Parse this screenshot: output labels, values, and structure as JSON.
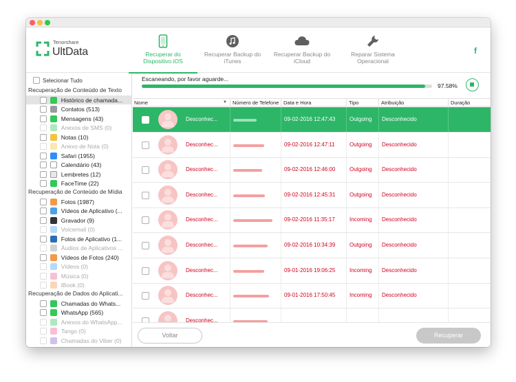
{
  "app": {
    "brand_small": "Tenorshare",
    "brand_big": "UltData",
    "accent": "#2db668"
  },
  "nav": [
    {
      "label1": "Recuperar do",
      "label2": "Dispositivo iOS",
      "icon": "phone-icon",
      "active": true
    },
    {
      "label1": "Recuperar Backup do",
      "label2": "iTunes",
      "icon": "music-note-icon",
      "active": false
    },
    {
      "label1": "Recuperar Backup do",
      "label2": "iCloud",
      "icon": "cloud-icon",
      "active": false
    },
    {
      "label1": "Reparar Sistema",
      "label2": "Operacional",
      "icon": "wrench-icon",
      "active": false
    }
  ],
  "facebook_label": "f",
  "sidebar": {
    "select_all": "Selecionar Tudo",
    "groups": [
      {
        "title": "Recuperação de Conteúdo de Texto",
        "items": [
          {
            "label": "Histórico de chamada...",
            "icon_color": "#34c759",
            "active": true
          },
          {
            "label": "Contatos (513)",
            "icon_color": "#9a9a9a"
          },
          {
            "label": "Mensagens (43)",
            "icon_color": "#34c759"
          },
          {
            "label": "Anexos de SMS (0)",
            "icon_color": "#34c759",
            "disabled": true
          },
          {
            "label": "Notas (10)",
            "icon_color": "#f5c242"
          },
          {
            "label": "Anexo de Nota (0)",
            "icon_color": "#f5c242",
            "disabled": true
          },
          {
            "label": "Safari (1955)",
            "icon_color": "#2f8ff5"
          },
          {
            "label": "Calendário (43)",
            "icon_color": "#ffffff"
          },
          {
            "label": "Lembretes (12)",
            "icon_color": "#e8e8e8"
          },
          {
            "label": "FaceTime (22)",
            "icon_color": "#34c759"
          }
        ]
      },
      {
        "title": "Recuperação de Conteúdo de Mídia",
        "items": [
          {
            "label": "Fotos (1987)",
            "icon_color": "#f2994a"
          },
          {
            "label": "Vídeos de Aplicativo (...",
            "icon_color": "#4aa3e8"
          },
          {
            "label": "Gravador (9)",
            "icon_color": "#333333"
          },
          {
            "label": "Voicemail (0)",
            "icon_color": "#4aa3e8",
            "disabled": true
          },
          {
            "label": "Fotos de Aplicativo (1...",
            "icon_color": "#2a6fb3"
          },
          {
            "label": "Áudios de Aplicativos ...",
            "icon_color": "#8e8e8e",
            "disabled": true
          },
          {
            "label": "Vídeos de Fotos (240)",
            "icon_color": "#f2994a"
          },
          {
            "label": "Vídeos (0)",
            "icon_color": "#4aa3e8",
            "disabled": true
          },
          {
            "label": "Música (0)",
            "icon_color": "#f06292",
            "disabled": true
          },
          {
            "label": "iBook (0)",
            "icon_color": "#f2994a",
            "disabled": true
          }
        ]
      },
      {
        "title": "Recuperação de Dados do Aplicati...",
        "items": [
          {
            "label": "Chamadas do Whats...",
            "icon_color": "#34c759"
          },
          {
            "label": "WhatsApp (565)",
            "icon_color": "#34c759"
          },
          {
            "label": "Anexos do WhatsApp...",
            "icon_color": "#34c759",
            "disabled": true
          },
          {
            "label": "Tango (0)",
            "icon_color": "#f06292",
            "disabled": true
          },
          {
            "label": "Chamadas do Viber (0)",
            "icon_color": "#8e5fd6",
            "disabled": true
          }
        ]
      }
    ]
  },
  "scan": {
    "status": "Escaneando, por favor aguarde...",
    "percent_text": "97.58%",
    "progress": 0.9758
  },
  "table": {
    "columns": [
      "Nome",
      "Número de Telefone",
      "Data e Hora",
      "Tipo",
      "Atribuição",
      "Duração"
    ],
    "rows": [
      {
        "name": "Desconhec...",
        "phone": "",
        "datetime": "09-02-2016 12:47:43",
        "type": "Outgoing",
        "attr": "Desconhecido",
        "duration": "",
        "selected": true
      },
      {
        "name": "Desconhec...",
        "phone": "",
        "datetime": "09-02-2016 12:47:11",
        "type": "Outgoing",
        "attr": "Desconhecido",
        "duration": ""
      },
      {
        "name": "Desconhec...",
        "phone": "",
        "datetime": "09-02-2016 12:46:00",
        "type": "Outgoing",
        "attr": "Desconhecido",
        "duration": ""
      },
      {
        "name": "Desconhec...",
        "phone": "",
        "datetime": "09-02-2016 12:45:31",
        "type": "Outgoing",
        "attr": "Desconhecido",
        "duration": ""
      },
      {
        "name": "Desconhec...",
        "phone": "",
        "datetime": "09-02-2016 11:35:17",
        "type": "Incoming",
        "attr": "Desconhecido",
        "duration": ""
      },
      {
        "name": "Desconhec...",
        "phone": "",
        "datetime": "09-02-2016 10:34:39",
        "type": "Outgoing",
        "attr": "Desconhecido",
        "duration": ""
      },
      {
        "name": "Desconhec...",
        "phone": "",
        "datetime": "09-01-2016 19:06:25",
        "type": "Incoming",
        "attr": "Desconhecido",
        "duration": ""
      },
      {
        "name": "Desconhec...",
        "phone": "",
        "datetime": "09-01-2016 17:50:45",
        "type": "Incoming",
        "attr": "Desconhecido",
        "duration": ""
      },
      {
        "name": "Desconhec...",
        "phone": "",
        "datetime": "",
        "type": "",
        "attr": "",
        "duration": ""
      }
    ]
  },
  "footer": {
    "back_label": "Voltar",
    "recover_label": "Recuperar"
  }
}
